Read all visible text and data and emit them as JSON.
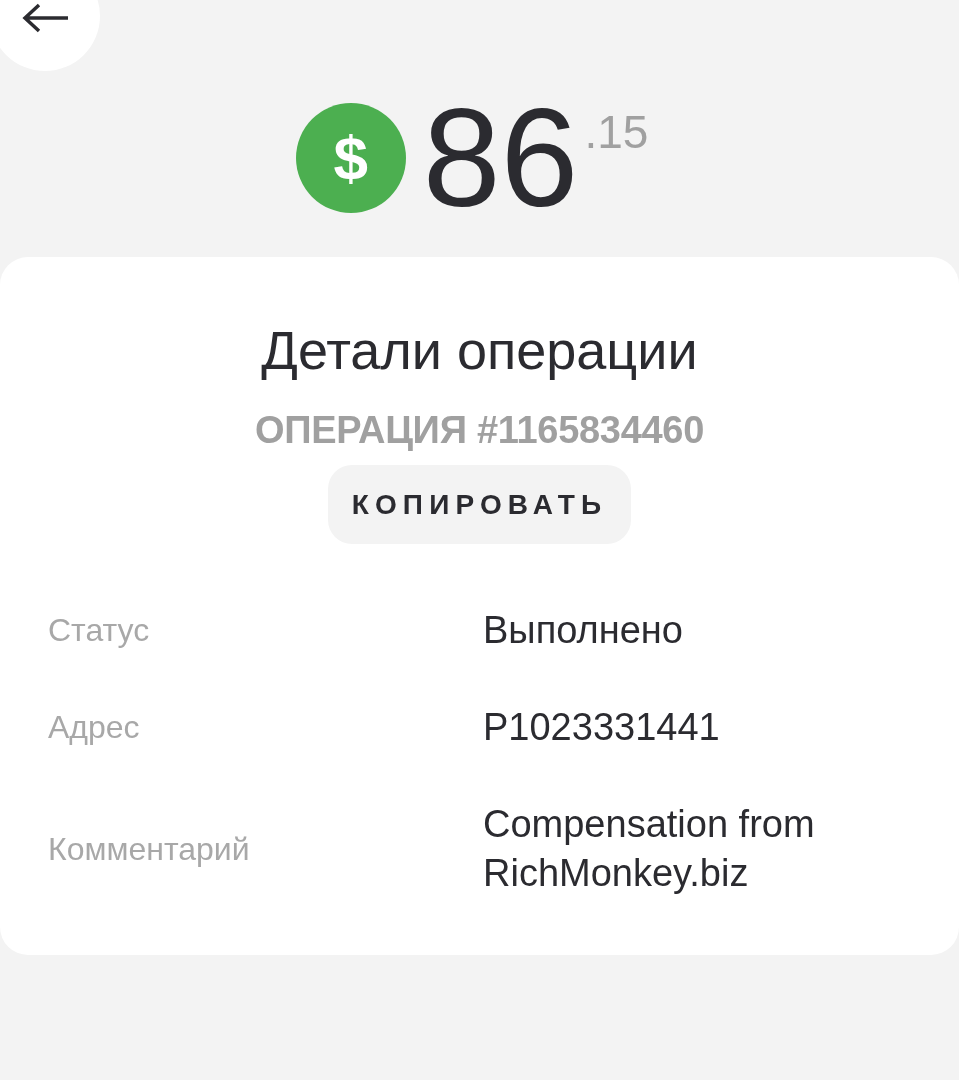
{
  "amount": {
    "currency_symbol": "$",
    "whole": "86",
    "fraction": ".15"
  },
  "details": {
    "title": "Детали операции",
    "operation": "ОПЕРАЦИЯ #1165834460",
    "copy_button": "КОПИРОВАТЬ",
    "rows": [
      {
        "label": "Статус",
        "value": "Выполнено"
      },
      {
        "label": "Адрес",
        "value": "P1023331441"
      },
      {
        "label": "Комментарий",
        "value": "Compensation from RichMonkey.biz"
      }
    ]
  }
}
